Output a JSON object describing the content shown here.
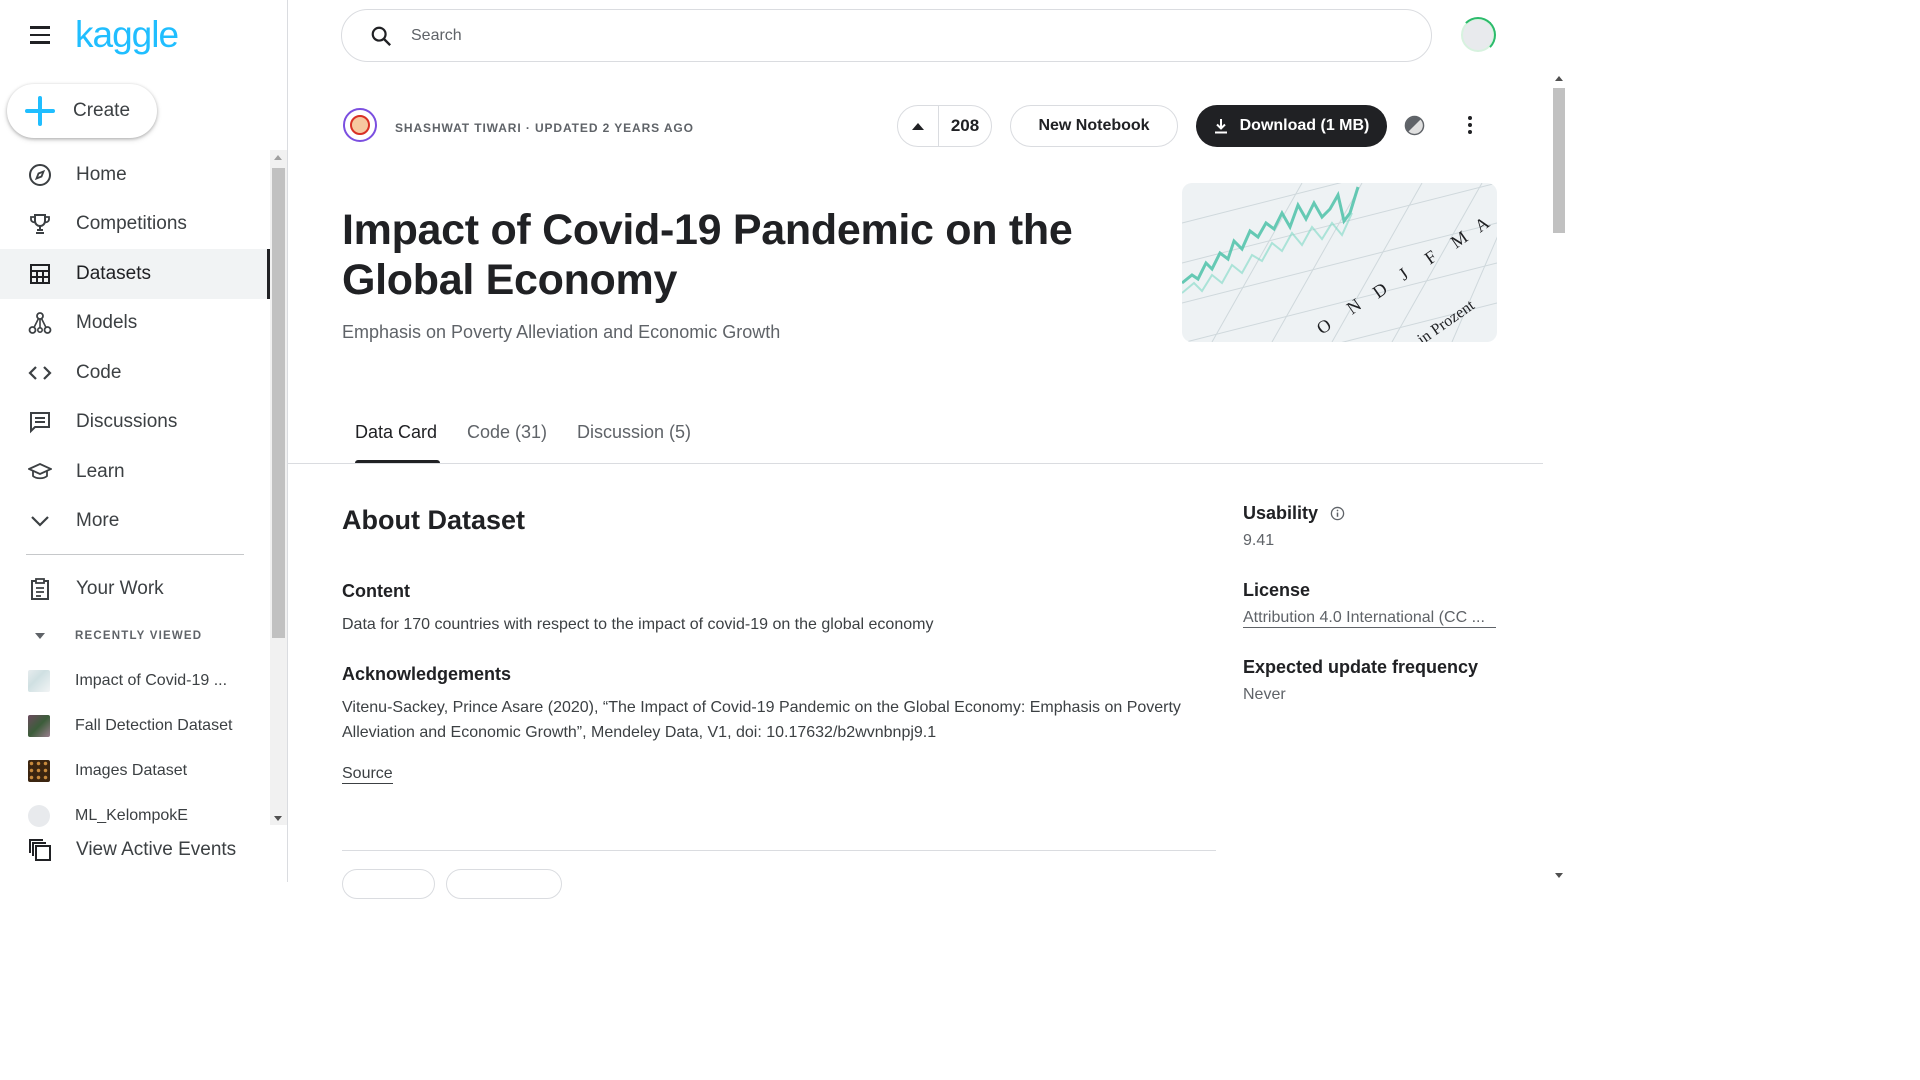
{
  "app": {
    "logo_text": "kaggle",
    "brand_color": "#20beff"
  },
  "sidebar": {
    "create_label": "Create",
    "items": [
      {
        "label": "Home",
        "icon": "compass-icon"
      },
      {
        "label": "Competitions",
        "icon": "trophy-icon"
      },
      {
        "label": "Datasets",
        "icon": "table-icon",
        "active": true
      },
      {
        "label": "Models",
        "icon": "models-icon"
      },
      {
        "label": "Code",
        "icon": "code-icon"
      },
      {
        "label": "Discussions",
        "icon": "discussion-icon"
      },
      {
        "label": "Learn",
        "icon": "graduation-cap-icon"
      },
      {
        "label": "More",
        "icon": "chevron-down-icon"
      }
    ],
    "your_work_label": "Your Work",
    "recently_viewed_label": "RECENTLY VIEWED",
    "recent": [
      {
        "label": "Impact of Covid-19 ..."
      },
      {
        "label": "Fall Detection Dataset"
      },
      {
        "label": "Images Dataset"
      },
      {
        "label": "ML_KelompokE"
      }
    ],
    "active_events_label": "View Active Events"
  },
  "search": {
    "placeholder": "Search",
    "value": ""
  },
  "dataset": {
    "author_line": "SHASHWAT TIWARI · UPDATED 2 YEARS AGO",
    "votes": "208",
    "new_notebook_label": "New Notebook",
    "download_label": "Download (1 MB)",
    "title": "Impact of Covid-19 Pandemic on the Global Economy",
    "subtitle": "Emphasis on Poverty Alleviation and Economic Growth",
    "cover_alt_letters": [
      "O",
      "N",
      "D",
      "J",
      "F",
      "M",
      "A",
      "in Prozent"
    ]
  },
  "tabs": [
    {
      "label": "Data Card",
      "active": true
    },
    {
      "label": "Code (31)"
    },
    {
      "label": "Discussion (5)"
    }
  ],
  "about": {
    "heading": "About Dataset",
    "content_heading": "Content",
    "content_text": "Data for 170 countries with respect to the impact of covid-19 on the global economy",
    "ack_heading": "Acknowledgements",
    "ack_text": "Vitenu-Sackey, Prince Asare (2020), “The Impact of Covid-19 Pandemic on the Global Economy: Emphasis on Poverty Alleviation and Economic Growth”, Mendeley Data, V1, doi: 10.17632/b2wvnbnpj9.1",
    "source_label": "Source"
  },
  "meta": {
    "usability_label": "Usability",
    "usability_value": "9.41",
    "license_label": "License",
    "license_value": "Attribution 4.0 International (CC ...",
    "update_label": "Expected update frequency",
    "update_value": "Never"
  }
}
